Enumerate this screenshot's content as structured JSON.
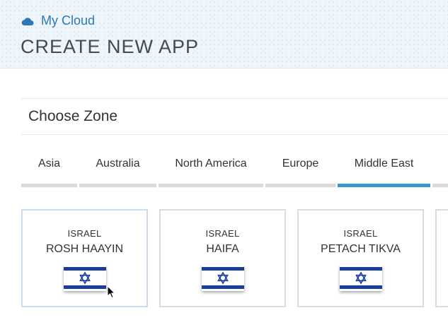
{
  "header": {
    "breadcrumb": "My Cloud",
    "title": "CREATE NEW APP",
    "icon": "cloud-icon",
    "accent_color": "#2d78b4"
  },
  "section": {
    "title": "Choose Zone"
  },
  "tabs": [
    {
      "label": "Asia",
      "active": false
    },
    {
      "label": "Australia",
      "active": false
    },
    {
      "label": "North America",
      "active": false
    },
    {
      "label": "Europe",
      "active": false
    },
    {
      "label": "Middle East",
      "active": true
    }
  ],
  "active_tab_color": "#3a97d0",
  "cards": [
    {
      "country": "ISRAEL",
      "city": "ROSH HAAYIN",
      "flag": "israel-flag-icon",
      "selected": true
    },
    {
      "country": "ISRAEL",
      "city": "HAIFA",
      "flag": "israel-flag-icon",
      "selected": false
    },
    {
      "country": "ISRAEL",
      "city": "PETACH TIKVA",
      "flag": "israel-flag-icon",
      "selected": false
    }
  ]
}
